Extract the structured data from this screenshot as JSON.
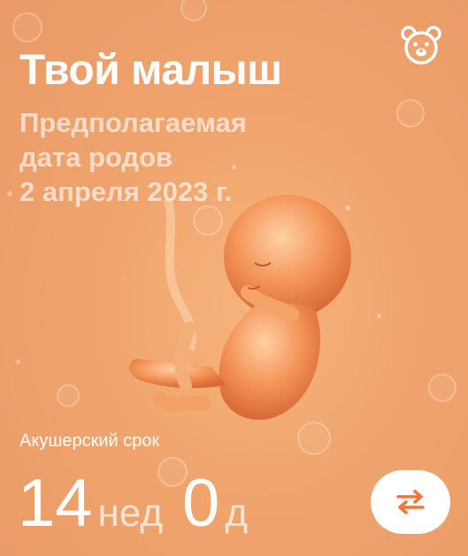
{
  "card": {
    "title": "Твой малыш",
    "due_line1": "Предполагаемая",
    "due_line2": "дата родов",
    "due_line3": "2 апреля 2023 г.",
    "term_label": "Акушерский срок",
    "weeks_value": "14",
    "weeks_unit": "нед",
    "days_value": "0",
    "days_unit": "д"
  },
  "icons": {
    "top_right": "bear-face-icon",
    "swap": "swap-arrows-icon"
  },
  "colors": {
    "background": "#f0a46d",
    "text": "#ffffff",
    "accent": "#f0773a"
  }
}
